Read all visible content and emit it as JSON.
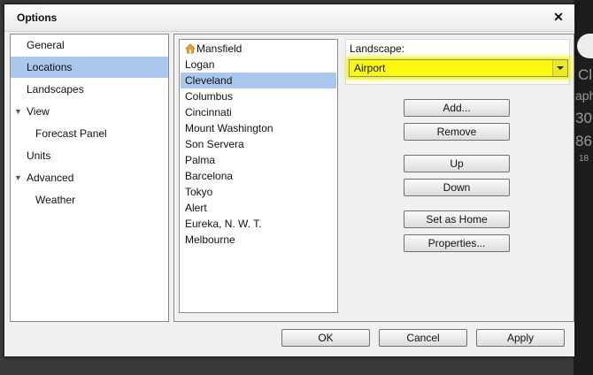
{
  "window": {
    "title": "Options"
  },
  "nav": {
    "items": [
      {
        "label": "General",
        "indent": 0,
        "expandable": false,
        "selected": false
      },
      {
        "label": "Locations",
        "indent": 0,
        "expandable": false,
        "selected": true
      },
      {
        "label": "Landscapes",
        "indent": 0,
        "expandable": false,
        "selected": false
      },
      {
        "label": "View",
        "indent": 0,
        "expandable": true,
        "selected": false
      },
      {
        "label": "Forecast Panel",
        "indent": 1,
        "expandable": false,
        "selected": false
      },
      {
        "label": "Units",
        "indent": 0,
        "expandable": false,
        "selected": false
      },
      {
        "label": "Advanced",
        "indent": 0,
        "expandable": true,
        "selected": false
      },
      {
        "label": "Weather",
        "indent": 1,
        "expandable": false,
        "selected": false
      }
    ]
  },
  "locations": {
    "home": "Mansfield",
    "items": [
      "Mansfield",
      "Logan",
      "Cleveland",
      "Columbus",
      "Cincinnati",
      "Mount Washington",
      "Son Servera",
      "Palma",
      "Barcelona",
      "Tokyo",
      "Alert",
      "Eureka, N. W. T.",
      "Melbourne"
    ],
    "selected": "Cleveland"
  },
  "landscape": {
    "label": "Landscape:",
    "value": "Airport",
    "highlight_color": "#fafa10"
  },
  "buttons": {
    "add": "Add...",
    "remove": "Remove",
    "up": "Up",
    "down": "Down",
    "set_home": "Set as Home",
    "properties": "Properties...",
    "ok": "OK",
    "cancel": "Cancel",
    "apply": "Apply"
  },
  "background": {
    "texts": [
      "Cl",
      "aph",
      "30",
      "86",
      "18"
    ]
  }
}
